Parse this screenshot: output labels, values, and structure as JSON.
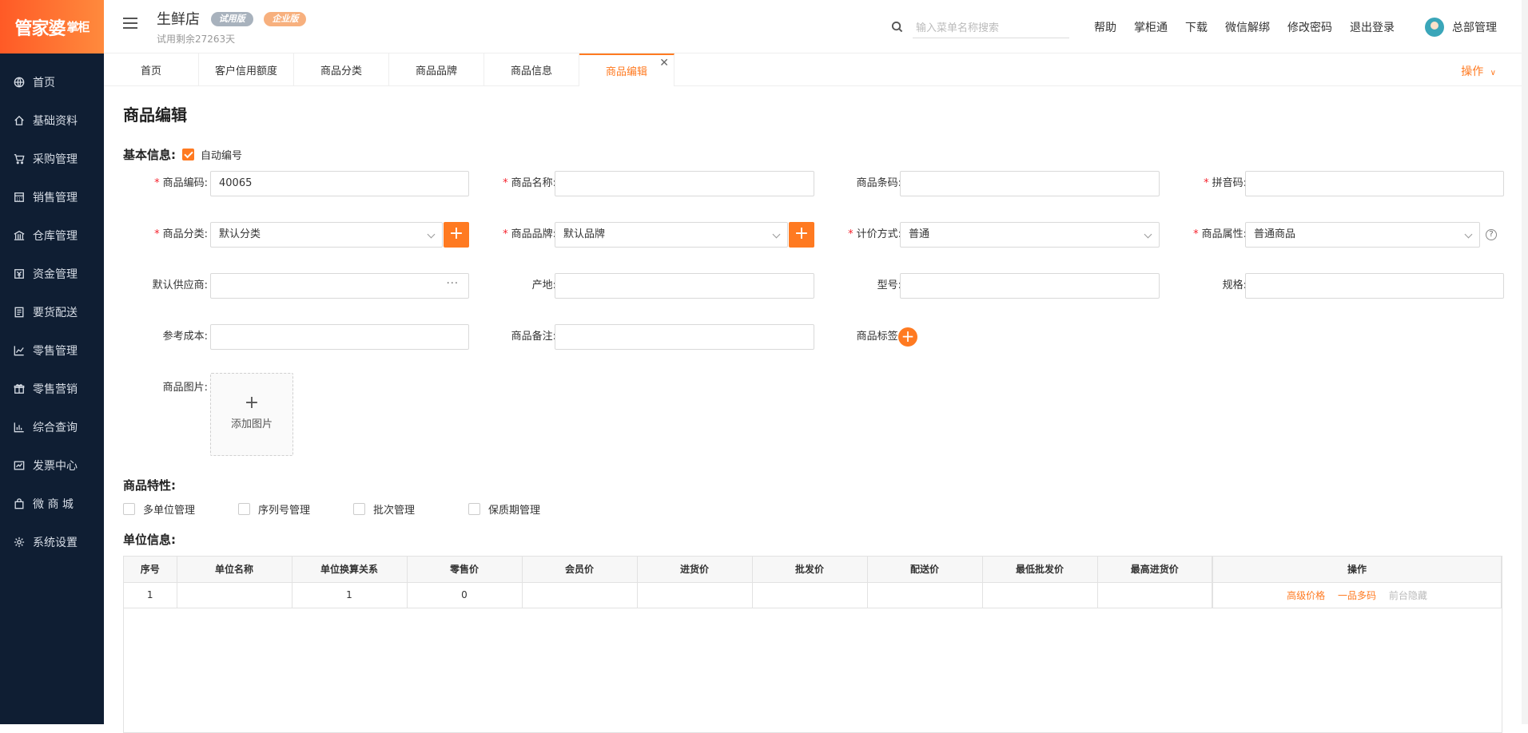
{
  "sidebar": {
    "logo_main": "管家婆",
    "logo_sub": "掌柜",
    "items": [
      {
        "label": "首页",
        "icon": "globe-icon"
      },
      {
        "label": "基础资料",
        "icon": "home-icon"
      },
      {
        "label": "采购管理",
        "icon": "cart-icon"
      },
      {
        "label": "销售管理",
        "icon": "calculator-icon"
      },
      {
        "label": "仓库管理",
        "icon": "warehouse-icon"
      },
      {
        "label": "资金管理",
        "icon": "money-icon"
      },
      {
        "label": "要货配送",
        "icon": "document-icon"
      },
      {
        "label": "零售管理",
        "icon": "chart-icon"
      },
      {
        "label": "零售营销",
        "icon": "gift-icon"
      },
      {
        "label": "综合查询",
        "icon": "bar-chart-icon"
      },
      {
        "label": "发票中心",
        "icon": "invoice-icon"
      },
      {
        "label": "微 商 城",
        "icon": "bag-icon"
      },
      {
        "label": "系统设置",
        "icon": "gear-icon"
      }
    ]
  },
  "header": {
    "store_name": "生鲜店",
    "badge_trial": "试用版",
    "badge_enterprise": "企业版",
    "trial_remaining": "试用剩余27263天",
    "search_placeholder": "输入菜单名称搜索",
    "links": [
      "帮助",
      "掌柜通",
      "下载",
      "微信解绑",
      "修改密码",
      "退出登录"
    ],
    "user_name": "总部管理"
  },
  "tabs": {
    "items": [
      "首页",
      "客户信用额度",
      "商品分类",
      "商品品牌",
      "商品信息",
      "商品编辑"
    ],
    "active_index": 5,
    "ops_label": "操作"
  },
  "form": {
    "page_title": "商品编辑",
    "basic_title": "基本信息:",
    "auto_number_label": "自动编号",
    "auto_number_checked": true,
    "labels": {
      "code": "商品编码:",
      "name": "商品名称:",
      "barcode": "商品条码:",
      "pinyin": "拼音码:",
      "category": "商品分类:",
      "brand": "商品品牌:",
      "pricing": "计价方式:",
      "attribute": "商品属性:",
      "supplier": "默认供应商:",
      "origin": "产地:",
      "model": "型号:",
      "spec": "规格:",
      "ref_cost": "参考成本:",
      "remark": "商品备注:",
      "tags": "商品标签:",
      "image": "商品图片:"
    },
    "values": {
      "code": "40065",
      "category": "默认分类",
      "brand": "默认品牌",
      "pricing": "普通",
      "attribute": "普通商品"
    },
    "add_image_label": "添加图片",
    "features_title": "商品特性:",
    "features": [
      "多单位管理",
      "序列号管理",
      "批次管理",
      "保质期管理"
    ],
    "units_title": "单位信息:"
  },
  "units_table": {
    "headers": [
      "序号",
      "单位名称",
      "单位换算关系",
      "零售价",
      "会员价",
      "进货价",
      "批发价",
      "配送价",
      "最低批发价",
      "最高进货价",
      "操作"
    ],
    "rows": [
      {
        "cells": [
          "1",
          "",
          "1",
          "0",
          "",
          "",
          "",
          "",
          "",
          ""
        ],
        "actions": [
          "高级价格",
          "一品多码",
          "前台隐藏"
        ]
      }
    ]
  },
  "colors": {
    "accent": "#ff7a21",
    "sidebar_bg": "#0f1e33"
  }
}
